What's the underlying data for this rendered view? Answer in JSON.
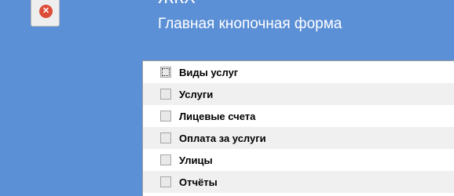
{
  "header": {
    "title": "ЖКХ",
    "subtitle": "Главная кнопочная форма"
  },
  "close_icon": "close-x-circle",
  "menu": {
    "items": [
      {
        "label": "Виды услуг"
      },
      {
        "label": "Услуги"
      },
      {
        "label": "Лицевые счета"
      },
      {
        "label": "Оплата за услуги"
      },
      {
        "label": "Улицы"
      },
      {
        "label": "Отчёты"
      }
    ]
  }
}
